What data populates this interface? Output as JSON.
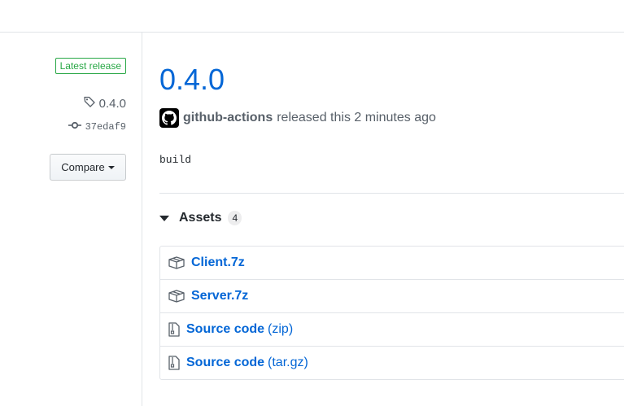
{
  "sidebar": {
    "badge": "Latest release",
    "tag": "0.4.0",
    "commit": "37edaf9",
    "compare_label": "Compare"
  },
  "release": {
    "title": "0.4.0",
    "author": "github-actions",
    "meta_text": "released this 2 minutes ago",
    "body": "build"
  },
  "assets": {
    "label": "Assets",
    "count": "4",
    "items": [
      {
        "name": "Client.7z",
        "suffix": "",
        "icon": "package-icon"
      },
      {
        "name": "Server.7z",
        "suffix": "",
        "icon": "package-icon"
      },
      {
        "name": "Source code",
        "suffix": "(zip)",
        "icon": "file-zip-icon"
      },
      {
        "name": "Source code",
        "suffix": "(tar.gz)",
        "icon": "file-zip-icon"
      }
    ]
  },
  "colors": {
    "link": "#0366d6",
    "badge_green": "#28a745",
    "muted": "#586069"
  }
}
